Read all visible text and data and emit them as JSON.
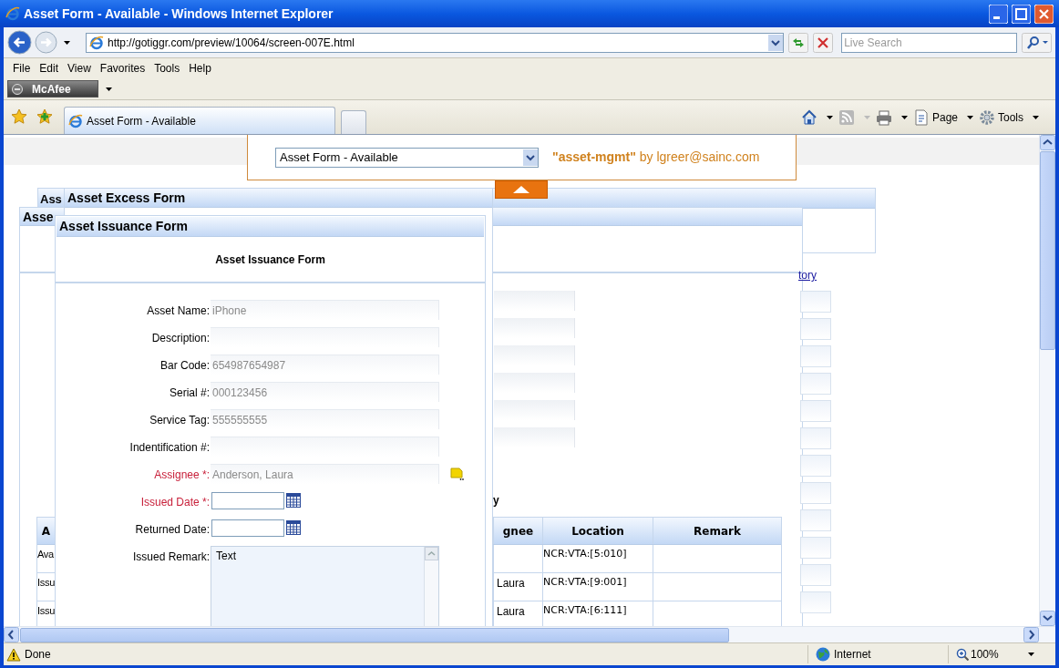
{
  "window": {
    "title": "Asset Form - Available - Windows Internet Explorer"
  },
  "address_bar": {
    "url": "http://gotiggr.com/preview/10064/screen-007E.html"
  },
  "search": {
    "placeholder": "Live Search"
  },
  "menu": [
    "File",
    "Edit",
    "View",
    "Favorites",
    "Tools",
    "Help"
  ],
  "mcafee": {
    "label": "McAfee"
  },
  "tabs": [
    {
      "label": "Asset Form - Available",
      "selected": true
    }
  ],
  "command_bar": [
    {
      "kind": "home"
    },
    {
      "kind": "feeds"
    },
    {
      "kind": "print"
    },
    {
      "kind": "page",
      "label": "Page"
    },
    {
      "kind": "tools",
      "label": "Tools"
    }
  ],
  "page": {
    "form_picker": {
      "value": "Asset Form - Available",
      "byline": "**\"asset-mgmt\"** by lgreer@sainc.com"
    },
    "back_panels": [
      {
        "title": "Ass"
      },
      {
        "title": "Asse"
      }
    ],
    "history_link": "tory",
    "history_heading": "y",
    "excess_form": {
      "title": "Asset Excess Form"
    },
    "issuance_form": {
      "title": "Asset Issuance Form",
      "heading": "Asset Issuance Form",
      "fields": [
        {
          "kind": "text",
          "label": "Asset Name:",
          "value": "iPhone",
          "required": false
        },
        {
          "kind": "text",
          "label": "Description:",
          "required": false
        },
        {
          "kind": "text",
          "label": "Bar Code:",
          "value": "654987654987",
          "required": false
        },
        {
          "kind": "text",
          "label": "Serial #:",
          "value": "000123456",
          "required": false
        },
        {
          "kind": "text",
          "label": "Service Tag:",
          "value": "555555555",
          "required": false
        },
        {
          "kind": "text",
          "label": "Indentification #:",
          "required": false
        },
        {
          "kind": "lookup",
          "label": "Assignee *:",
          "value": "Anderson, Laura",
          "required": true
        },
        {
          "kind": "date",
          "label": "Issued Date *:",
          "required": true
        },
        {
          "kind": "date",
          "label": "Returned Date:",
          "required": false
        },
        {
          "kind": "textarea",
          "label": "Issued Remark:",
          "value": "Text",
          "required": false
        }
      ]
    },
    "history_table": {
      "columns": [
        "A",
        "gnee",
        "Location",
        "Remark"
      ],
      "rows": [
        {
          "column_1": "Ava",
          "location": "NCR:VTA:[5:010]"
        },
        {
          "column_1": "Issu",
          "assignee": "Laura",
          "location": "NCR:VTA:[9:001]"
        },
        {
          "column_1": "Issu",
          "assignee": "Laura",
          "location": "NCR:VTA:[6:111]"
        }
      ]
    }
  },
  "status_bar": {
    "text": "Done",
    "zone": "Internet",
    "zoom": "100%"
  }
}
